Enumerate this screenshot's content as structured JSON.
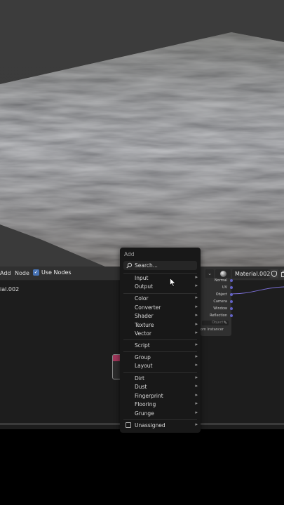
{
  "node_editor": {
    "header": {
      "add_label": "Add",
      "node_label": "Node",
      "use_nodes_label": "Use Nodes",
      "use_nodes_checked": true,
      "material_name": "Material.002"
    },
    "left_material_label": "ial.002",
    "tex_coord_node": {
      "outputs": [
        "Normal",
        "UV",
        "Object",
        "Camera",
        "Window",
        "Reflection"
      ],
      "object_field": "Object",
      "from_instancer_label": "om Instancer"
    }
  },
  "add_menu": {
    "title": "Add",
    "search_label": "Search...",
    "groups": [
      [
        "Input",
        "Output"
      ],
      [
        "Color",
        "Converter",
        "Shader",
        "Texture",
        "Vector"
      ],
      [
        "Script"
      ],
      [
        "Group",
        "Layout"
      ],
      [
        "Dirt",
        "Dust",
        "Fingerprint",
        "Flooring",
        "Grunge"
      ],
      [
        "Unassigned"
      ]
    ],
    "icons": {
      "search": "search-icon",
      "submenu": "chevron-right-icon",
      "unassigned": "folder-icon"
    }
  },
  "colors": {
    "accent": "#4772b3",
    "socket": "#6363c7",
    "link": "#7b6fd6"
  }
}
